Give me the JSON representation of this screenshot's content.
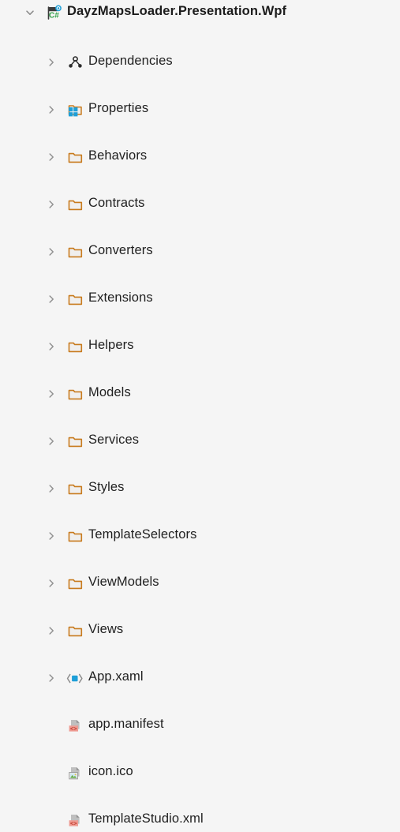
{
  "theme": {
    "background": "#F5F5F5",
    "text_color": "#1F1F1F",
    "chevron_color": "#919191",
    "folder_outline": "#C87B1E",
    "folder_fill": "#F0EFEE",
    "csharp_green": "#2E9E45",
    "badge_blue": "#1E9FD8",
    "xaml_blue": "#1E9FD8",
    "code_badge_salmon": "#EE9B92",
    "code_badge_text": "#C0392B",
    "doc_gray": "#A9A9A9"
  },
  "tree": {
    "root": {
      "label": "DayzMapsLoader.Presentation.Wpf",
      "icon": "csharp-project-icon",
      "expander": "chevron-down-icon",
      "expanded": true
    },
    "children": [
      {
        "label": "Dependencies",
        "icon": "dependencies-icon",
        "expander": "chevron-right-icon"
      },
      {
        "label": "Properties",
        "icon": "properties-folder-icon",
        "expander": "chevron-right-icon"
      },
      {
        "label": "Behaviors",
        "icon": "folder-icon",
        "expander": "chevron-right-icon"
      },
      {
        "label": "Contracts",
        "icon": "folder-icon",
        "expander": "chevron-right-icon"
      },
      {
        "label": "Converters",
        "icon": "folder-icon",
        "expander": "chevron-right-icon"
      },
      {
        "label": "Extensions",
        "icon": "folder-icon",
        "expander": "chevron-right-icon"
      },
      {
        "label": "Helpers",
        "icon": "folder-icon",
        "expander": "chevron-right-icon"
      },
      {
        "label": "Models",
        "icon": "folder-icon",
        "expander": "chevron-right-icon"
      },
      {
        "label": "Services",
        "icon": "folder-icon",
        "expander": "chevron-right-icon"
      },
      {
        "label": "Styles",
        "icon": "folder-icon",
        "expander": "chevron-right-icon"
      },
      {
        "label": "TemplateSelectors",
        "icon": "folder-icon",
        "expander": "chevron-right-icon"
      },
      {
        "label": "ViewModels",
        "icon": "folder-icon",
        "expander": "chevron-right-icon"
      },
      {
        "label": "Views",
        "icon": "folder-icon",
        "expander": "chevron-right-icon"
      },
      {
        "label": "App.xaml",
        "icon": "xaml-file-icon",
        "expander": "chevron-right-icon"
      },
      {
        "label": "app.manifest",
        "icon": "manifest-file-icon",
        "expander": null
      },
      {
        "label": "icon.ico",
        "icon": "image-file-icon",
        "expander": null
      },
      {
        "label": "TemplateStudio.xml",
        "icon": "xml-file-icon",
        "expander": null
      }
    ]
  }
}
